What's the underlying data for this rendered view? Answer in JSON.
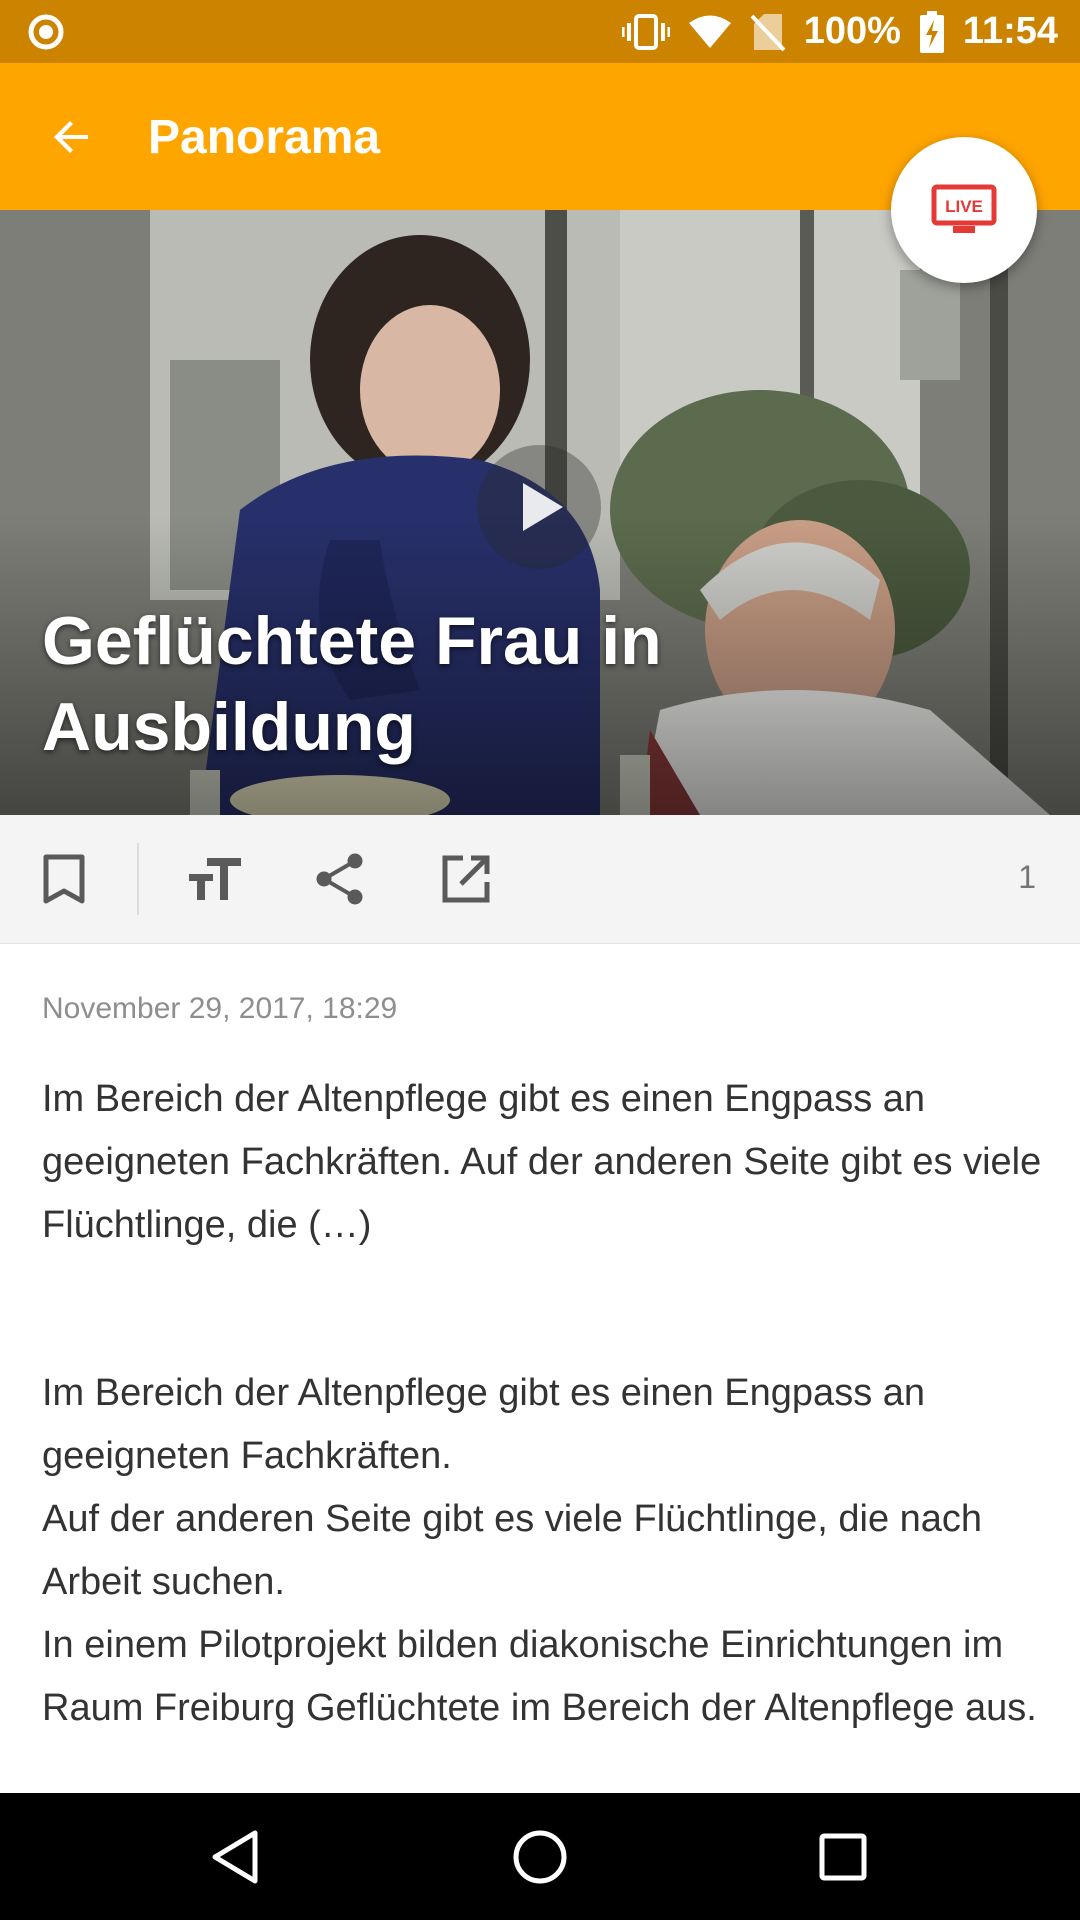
{
  "status_bar": {
    "battery": "100%",
    "time": "11:54",
    "icons": [
      "notification-dot-icon",
      "vibrate-icon",
      "wifi-icon",
      "no-sim-icon",
      "battery-charging-icon"
    ]
  },
  "app_bar": {
    "title": "Panorama",
    "back_icon": "arrow-back-icon",
    "live_label": "LIVE"
  },
  "hero": {
    "title": "Geflüchtete Frau in Ausbildung",
    "play_icon": "play-icon"
  },
  "toolbar": {
    "icons": [
      "bookmark-icon",
      "text-size-icon",
      "share-icon",
      "open-external-icon"
    ],
    "comment_count": "1"
  },
  "article": {
    "date": "November 29, 2017, 18:29",
    "teaser": "Im Bereich der Altenpflege gibt es einen Engpass an geeigneten Fachkräften. Auf der anderen Seite gibt es viele Flüchtlinge, die (…)",
    "paragraphs": [
      "Im Bereich der Altenpflege gibt es einen Engpass an geeigneten Fachkräften.",
      "Auf der anderen Seite gibt es viele Flüchtlinge, die nach Arbeit suchen.",
      "In einem Pilotprojekt bilden diakonische Einrichtungen im Raum Freiburg Geflüchtete im Bereich der Altenpflege aus."
    ]
  },
  "nav_bar": {
    "icons": [
      "nav-back-icon",
      "nav-home-icon",
      "nav-recents-icon"
    ]
  },
  "colors": {
    "status_bar": "#cc8400",
    "app_bar": "#ffa500",
    "live_red": "#e53935"
  }
}
